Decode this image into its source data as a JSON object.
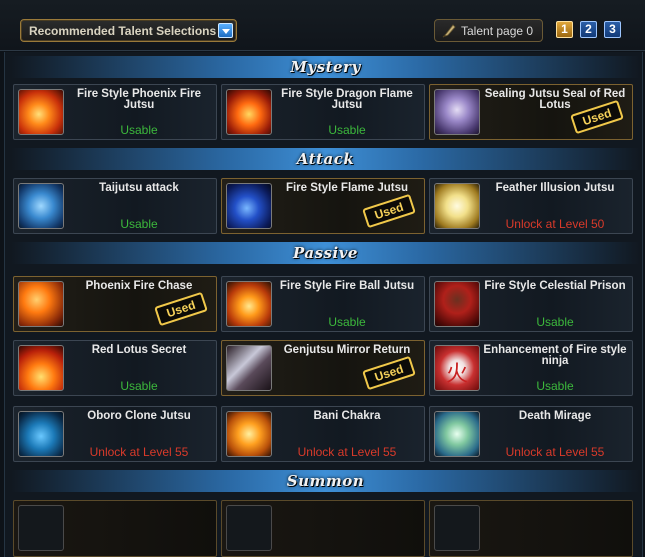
{
  "header": {
    "recommend_label": "Recommended Talent Selections",
    "talent_page_label": "Talent page 0",
    "pages": [
      "1",
      "2",
      "3"
    ],
    "active_page": "1"
  },
  "sections": {
    "mystery": "Mystery",
    "attack": "Attack",
    "passive": "Passive",
    "summon": "Summon"
  },
  "used_label": "Used",
  "cards": [
    {
      "name": "Fire Style  Phoenix Fire Jutsu",
      "status": "Usable",
      "state": "usable",
      "icon": "phoenix-fire-icon"
    },
    {
      "name": "Fire Style  Dragon Flame Jutsu",
      "status": "Usable",
      "state": "usable",
      "icon": "dragon-flame-icon"
    },
    {
      "name": "Sealing Jutsu  Seal of Red Lotus",
      "status": "",
      "state": "used",
      "icon": "seal-icon"
    },
    {
      "name": "Taijutsu attack",
      "status": "Usable",
      "state": "usable",
      "icon": "fist-icon"
    },
    {
      "name": "Fire Style  Flame Jutsu",
      "status": "",
      "state": "used",
      "icon": "blue-flame-icon"
    },
    {
      "name": "Feather Illusion Jutsu",
      "status": "Unlock at Level 50",
      "state": "locked",
      "icon": "feather-icon"
    },
    {
      "name": "Phoenix Fire  Chase",
      "status": "",
      "state": "used",
      "icon": "phoenix-chase-icon"
    },
    {
      "name": "Fire Style  Fire Ball Jutsu",
      "status": "Usable",
      "state": "usable",
      "icon": "fireball-icon"
    },
    {
      "name": "Fire Style  Celestial Prison",
      "status": "Usable",
      "state": "usable",
      "icon": "celestial-prison-icon"
    },
    {
      "name": "Red Lotus Secret",
      "status": "Usable",
      "state": "usable",
      "icon": "red-lotus-icon"
    },
    {
      "name": "Genjutsu  Mirror Return",
      "status": "",
      "state": "used",
      "icon": "mirror-icon"
    },
    {
      "name": "Enhancement of Fire style ninja",
      "status": "Usable",
      "state": "usable",
      "icon": "fire-kanji-icon"
    },
    {
      "name": "Oboro Clone Jutsu",
      "status": "Unlock at Level 55",
      "state": "locked",
      "icon": "clone-icon"
    },
    {
      "name": "Bani Chakra",
      "status": "Unlock at Level 55",
      "state": "locked",
      "icon": "chakra-icon"
    },
    {
      "name": "Death Mirage",
      "status": "Unlock at Level 55",
      "state": "locked",
      "icon": "mirage-icon"
    }
  ]
}
